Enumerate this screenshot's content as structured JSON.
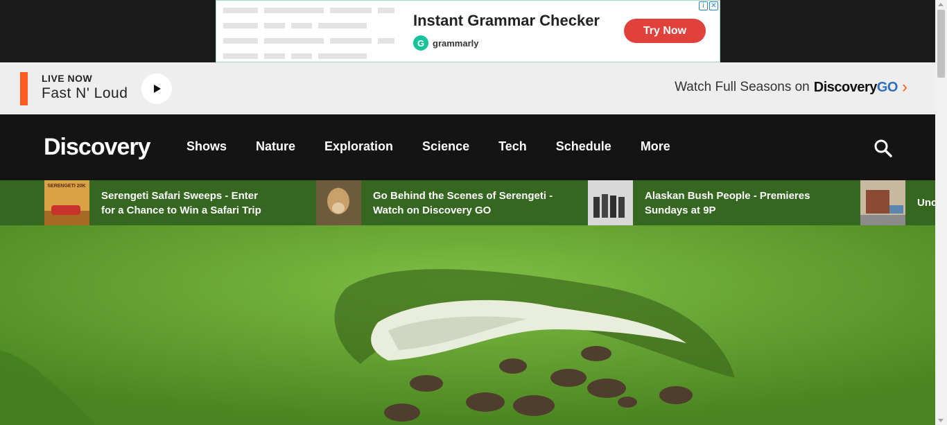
{
  "ad": {
    "headline": "Instant Grammar Checker",
    "brand": "grammarly",
    "brand_initial": "G",
    "cta": "Try Now",
    "choices_icons": [
      "info-icon",
      "close-icon"
    ],
    "accent_color": "#e0413b",
    "brand_color": "#15c39a"
  },
  "live": {
    "label": "LIVE NOW",
    "show": "Fast N' Loud",
    "accent_color": "#ff5a1f"
  },
  "watch_full": {
    "text": "Watch Full Seasons on",
    "brand_main": "Discovery",
    "brand_suffix": "GO"
  },
  "nav": {
    "logo": "Discovery",
    "items": [
      "Shows",
      "Nature",
      "Exploration",
      "Science",
      "Tech",
      "Schedule",
      "More"
    ]
  },
  "promos": [
    {
      "text": "Serengeti Safari Sweeps - Enter for a Chance to Win a Safari Trip",
      "thumb_text": "SERENGETI 20K"
    },
    {
      "text": "Go Behind the Scenes of Serengeti - Watch on Discovery GO"
    },
    {
      "text": "Alaskan Bush People - Premieres Sundays at 9P"
    },
    {
      "text": "Unc Pre"
    }
  ]
}
